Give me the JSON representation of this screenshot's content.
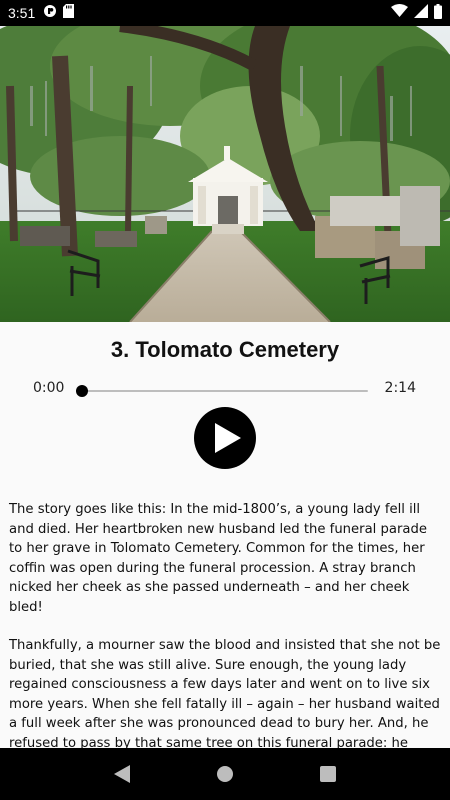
{
  "status_bar": {
    "time": "3:51",
    "left_icons": [
      "screen-record-icon",
      "sd-card-icon"
    ],
    "right_icons": [
      "wifi-icon",
      "cellular-signal-icon",
      "battery-icon"
    ]
  },
  "hero_image": {
    "description_icon": "cemetery-photo"
  },
  "track": {
    "title": "3. Tolomato Cemetery",
    "elapsed": "0:00",
    "duration": "2:14",
    "progress": 0
  },
  "controls": {
    "play_icon": "play-icon"
  },
  "story": {
    "paragraphs": [
      "The story goes like this: In the mid-1800’s, a young lady fell ill and died. Her heartbroken new husband led the funeral parade to her grave in Tolomato Cemetery. Common for the times, her coffin was open during the funeral procession. A stray branch nicked her cheek as she passed underneath – and her cheek bled!",
      "Thankfully, a mourner saw the blood and insisted that she not be buried, that she was still alive. Sure enough, the young lady regained consciousness a few days later and went on to live six more years. When she fell fatally ill – again – her husband waited a full week after she was pronounced dead to bury her. And, he refused to pass by that same tree on this funeral parade: he claimed he couldn’t handle it if she wasn’t dead"
    ]
  },
  "nav_bar": {
    "back_icon": "back-icon",
    "home_icon": "home-icon",
    "recents_icon": "recents-icon"
  }
}
